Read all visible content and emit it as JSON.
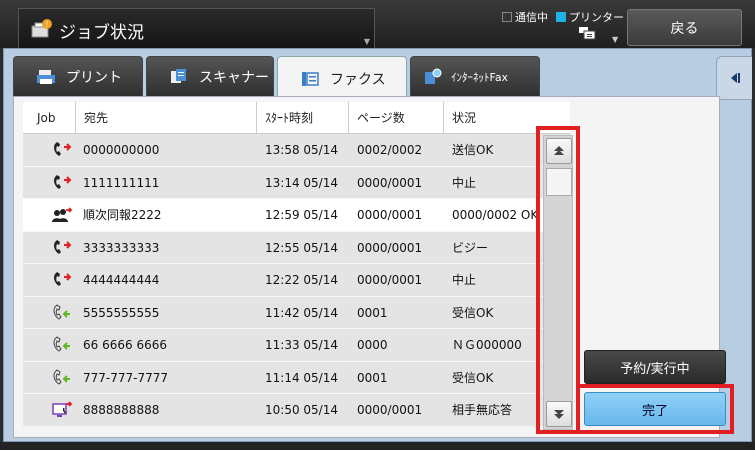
{
  "header": {
    "title": "ジョブ状況",
    "status_comm": "通信中",
    "status_printer": "プリンター",
    "back_label": "戻る"
  },
  "tabs": [
    {
      "label": "プリント"
    },
    {
      "label": "スキャナー"
    },
    {
      "label": "ファクス"
    },
    {
      "label": "ｲﾝﾀｰﾈｯﾄFax"
    }
  ],
  "table": {
    "columns": [
      "Job",
      "宛先",
      "ｽﾀｰﾄ時刻",
      "ページ数",
      "状況"
    ],
    "rows": [
      {
        "icon": "fax-send-icon",
        "dest": "0000000000",
        "time": "13:58 05/14",
        "pages": "0002/0002",
        "status": "送信OK"
      },
      {
        "icon": "fax-send-icon",
        "dest": "1111111111",
        "time": "13:14 05/14",
        "pages": "0000/0001",
        "status": "中止"
      },
      {
        "icon": "broadcast-icon",
        "dest": "順次同報2222",
        "time": "12:59 05/14",
        "pages": "0000/0001",
        "status": "0000/0002 OK"
      },
      {
        "icon": "fax-send-icon",
        "dest": "3333333333",
        "time": "12:55 05/14",
        "pages": "0000/0001",
        "status": "ビジー"
      },
      {
        "icon": "fax-send-icon",
        "dest": "4444444444",
        "time": "12:22 05/14",
        "pages": "0000/0001",
        "status": "中止"
      },
      {
        "icon": "fax-receive-icon",
        "dest": "5555555555",
        "time": "11:42 05/14",
        "pages": "0001",
        "status": "受信OK"
      },
      {
        "icon": "fax-receive-icon",
        "dest": "66 6666 6666",
        "time": "11:33 05/14",
        "pages": "0000",
        "status": "ＮＧ000000"
      },
      {
        "icon": "fax-receive-icon",
        "dest": "777-777-7777",
        "time": "11:14 05/14",
        "pages": "0001",
        "status": "受信OK"
      },
      {
        "icon": "pc-fax-icon",
        "dest": "8888888888",
        "time": "10:50 05/14",
        "pages": "0000/0001",
        "status": "相手無応答"
      }
    ]
  },
  "buttons": {
    "reserve": "予約/実行中",
    "done": "完了"
  },
  "colors": {
    "highlight": "#e01e24",
    "accent": "#1db3e8",
    "done_button": "#7ec6f3"
  }
}
